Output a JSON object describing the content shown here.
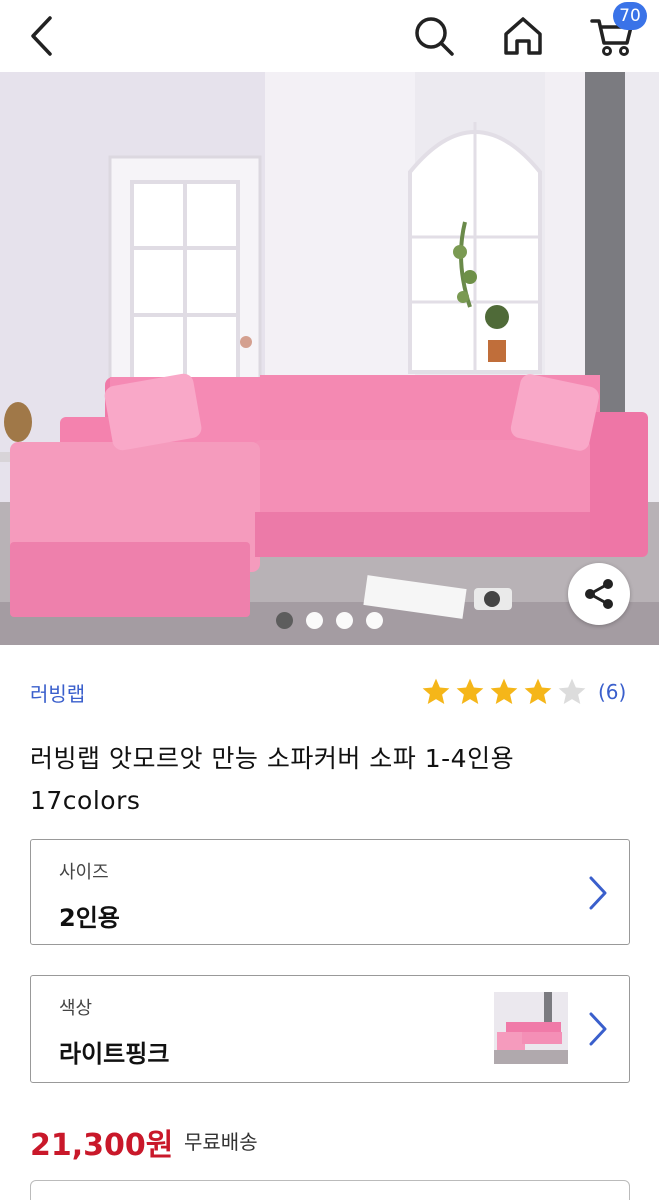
{
  "header": {
    "cart_count": "70"
  },
  "gallery": {
    "image_count": 4,
    "active_index": 0
  },
  "product": {
    "brand": "러빙랩",
    "rating": 4,
    "rating_max": 5,
    "review_count": "(6)",
    "title": "러빙랩 앗모르앗 만능 소파커버 소파 1-4인용 17colors"
  },
  "options": {
    "size_label": "사이즈",
    "size_value": "2인용",
    "color_label": "색상",
    "color_value": "라이트핑크"
  },
  "pricing": {
    "price": "21,300원",
    "shipping": "무료배송"
  },
  "colors": {
    "accent_blue": "#3a73e8",
    "brand_blue": "#3a5fcc",
    "price_red": "#c9182a",
    "star_gold": "#f5b619",
    "sofa_pink": "#f48fb6"
  },
  "icons": [
    "back-arrow-icon",
    "search-icon",
    "home-icon",
    "cart-icon",
    "share-icon",
    "star-icon",
    "chevron-right-icon"
  ]
}
